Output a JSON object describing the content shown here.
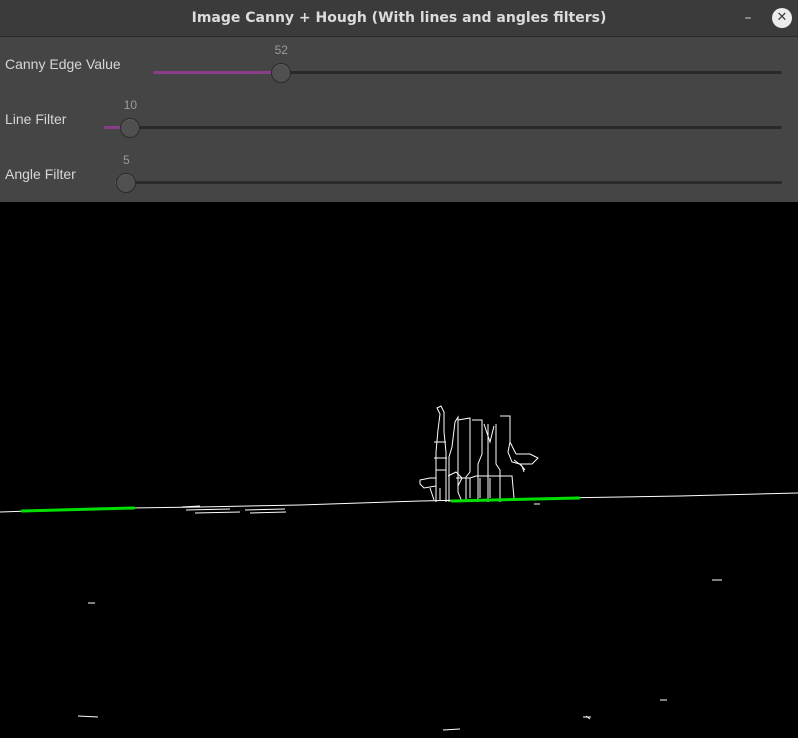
{
  "window": {
    "title": "Image Canny + Hough (With lines and angles filters)",
    "minimize_symbol": "–",
    "close_symbol": "✕"
  },
  "sliders": [
    {
      "label": "Canny Edge Value",
      "value": "52",
      "fraction": 0.204
    },
    {
      "label": "Line Filter",
      "value": "10",
      "fraction": 0.039
    },
    {
      "label": "Angle Filter",
      "value": "5",
      "fraction": 0.017
    }
  ],
  "colors": {
    "panel": "#454545",
    "slider_fill": "#8a3d8a",
    "canvas_bg": "#000000",
    "edges": "#ffffff",
    "hough_lines": "#00e000"
  }
}
